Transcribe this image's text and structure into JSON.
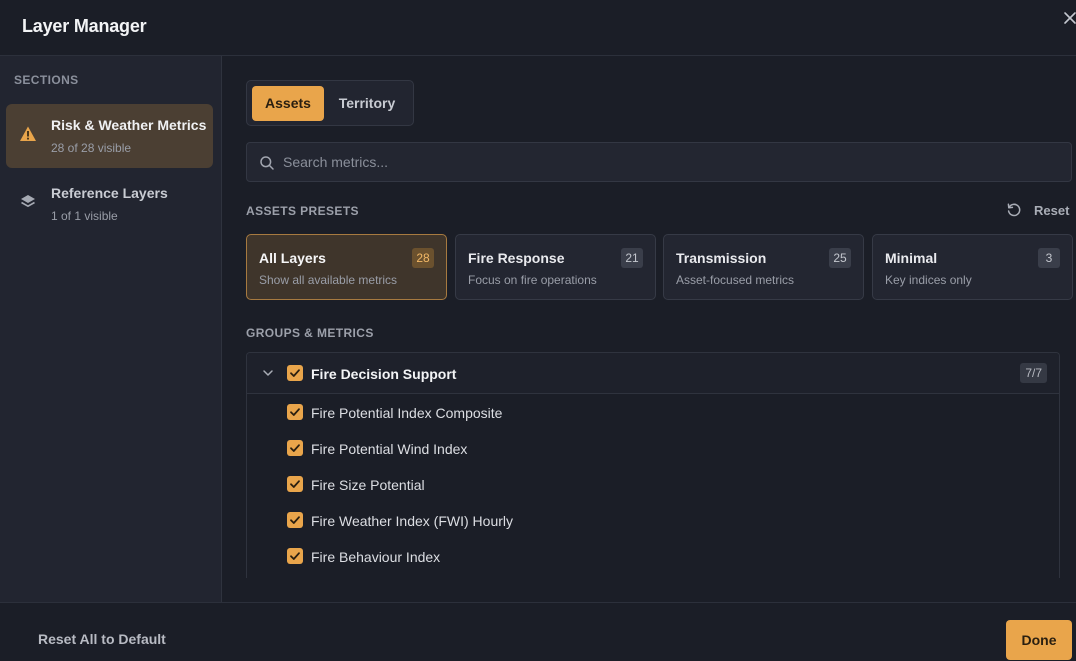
{
  "header": {
    "title": "Layer Manager",
    "close_icon": "close-icon"
  },
  "sidebar": {
    "sections_label": "SECTIONS",
    "items": [
      {
        "label": "Risk & Weather Metrics",
        "sub": "28 of 28 visible",
        "icon": "warning-icon",
        "active": true
      },
      {
        "label": "Reference Layers",
        "sub": "1 of 1 visible",
        "icon": "layers-icon",
        "active": false
      }
    ]
  },
  "tabs": [
    {
      "label": "Assets",
      "active": true
    },
    {
      "label": "Territory",
      "active": false
    }
  ],
  "search": {
    "placeholder": "Search metrics...",
    "value": ""
  },
  "presets": {
    "label": "ASSETS PRESETS",
    "reset_label": "Reset",
    "items": [
      {
        "name": "All Layers",
        "desc": "Show all available metrics",
        "count": "28",
        "active": true
      },
      {
        "name": "Fire Response",
        "desc": "Focus on fire operations",
        "count": "21",
        "active": false
      },
      {
        "name": "Transmission",
        "desc": "Asset-focused metrics",
        "count": "25",
        "active": false
      },
      {
        "name": "Minimal",
        "desc": "Key indices only",
        "count": "3",
        "active": false
      }
    ]
  },
  "groups": {
    "label": "GROUPS & METRICS",
    "items": [
      {
        "name": "Fire Decision Support",
        "count": "7/7",
        "checked": true,
        "expanded": true,
        "metrics": [
          {
            "name": "Fire Potential Index Composite",
            "checked": true
          },
          {
            "name": "Fire Potential Wind Index",
            "checked": true
          },
          {
            "name": "Fire Size Potential",
            "checked": true
          },
          {
            "name": "Fire Weather Index (FWI) Hourly",
            "checked": true
          },
          {
            "name": "Fire Behaviour Index",
            "checked": true
          }
        ]
      }
    ]
  },
  "footer": {
    "reset_all_label": "Reset All to Default",
    "done_label": "Done"
  },
  "colors": {
    "accent": "#e9a54b",
    "background": "#1b1e27",
    "sidebar": "#222530"
  }
}
